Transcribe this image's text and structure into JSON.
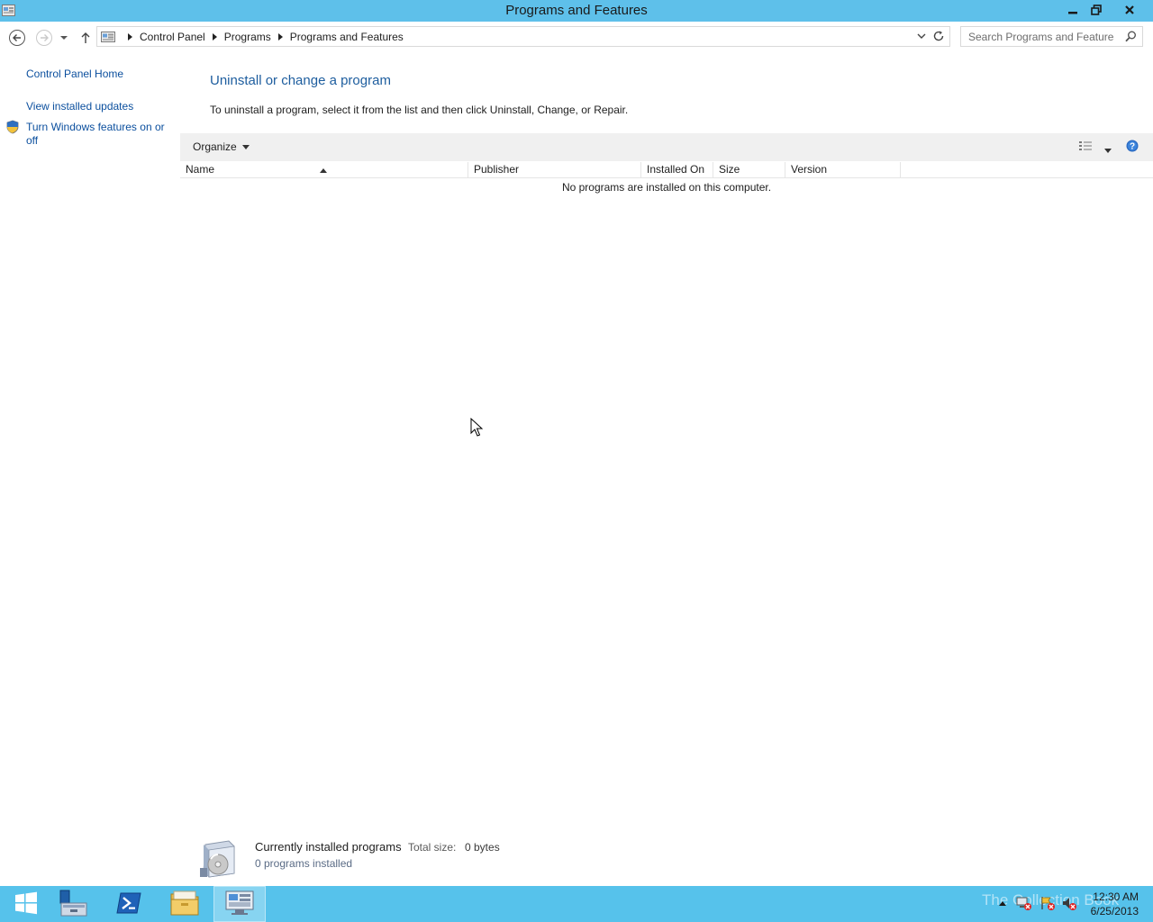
{
  "window": {
    "title": "Programs and Features"
  },
  "address": {
    "breadcrumbs": [
      "Control Panel",
      "Programs",
      "Programs and Features"
    ],
    "search_placeholder": "Search Programs and Features"
  },
  "sidebar": {
    "items": [
      {
        "label": "Control Panel Home"
      },
      {
        "label": "View installed updates"
      },
      {
        "label": "Turn Windows features on or off",
        "icon": "uac-shield-icon"
      }
    ]
  },
  "main": {
    "heading": "Uninstall or change a program",
    "description": "To uninstall a program, select it from the list and then click Uninstall, Change, or Repair.",
    "toolbar": {
      "organize_label": "Organize"
    },
    "columns": [
      "Name",
      "Publisher",
      "Installed On",
      "Size",
      "Version"
    ],
    "sorted_column": "Name",
    "empty_message": "No programs are installed on this computer."
  },
  "details": {
    "title": "Currently installed programs",
    "total_size_label": "Total size:",
    "total_size_value": "0 bytes",
    "count_text": "0 programs installed"
  },
  "taskbar": {
    "items": [
      "start-icon",
      "server-manager-icon",
      "powershell-icon",
      "file-explorer-icon",
      "control-panel-icon"
    ],
    "active_item": "control-panel-icon",
    "watermark": "The Collection Book",
    "time": "12:30 AM",
    "date": "6/25/2013"
  },
  "colors": {
    "titlebar": "#5ec0ea",
    "taskbar": "#56c2eb",
    "link": "#0b4f9e",
    "heading": "#1d5d9e"
  }
}
